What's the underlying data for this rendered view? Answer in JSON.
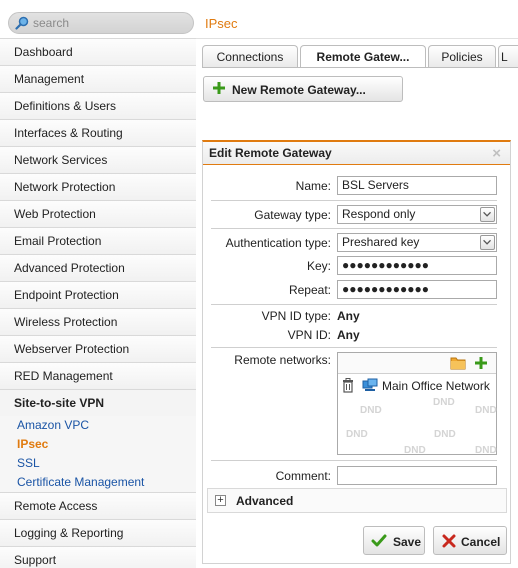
{
  "search": {
    "placeholder": "search"
  },
  "header": {
    "title": "IPsec"
  },
  "sidebar": {
    "items": [
      {
        "label": "Dashboard"
      },
      {
        "label": "Management"
      },
      {
        "label": "Definitions & Users"
      },
      {
        "label": "Interfaces & Routing"
      },
      {
        "label": "Network Services"
      },
      {
        "label": "Network Protection"
      },
      {
        "label": "Web Protection"
      },
      {
        "label": "Email Protection"
      },
      {
        "label": "Advanced Protection"
      },
      {
        "label": "Endpoint Protection"
      },
      {
        "label": "Wireless Protection"
      },
      {
        "label": "Webserver Protection"
      },
      {
        "label": "RED Management"
      }
    ],
    "section": {
      "label": "Site-to-site VPN"
    },
    "sub_items": [
      {
        "label": "Amazon VPC"
      },
      {
        "label": "IPsec"
      },
      {
        "label": "SSL"
      },
      {
        "label": "Certificate Management"
      }
    ],
    "bottom_items": [
      {
        "label": "Remote Access"
      },
      {
        "label": "Logging & Reporting"
      },
      {
        "label": "Support"
      }
    ]
  },
  "tabs": [
    {
      "label": "Connections"
    },
    {
      "label": "Remote Gatew..."
    },
    {
      "label": "Policies"
    },
    {
      "label": "L"
    }
  ],
  "toolbar": {
    "new_label": "New Remote Gateway..."
  },
  "dialog": {
    "title": "Edit Remote Gateway",
    "close": "×",
    "name_label": "Name:",
    "name_value": "BSL Servers",
    "gateway_type_label": "Gateway type:",
    "gateway_type_value": "Respond only",
    "auth_type_label": "Authentication type:",
    "auth_type_value": "Preshared key",
    "key_label": "Key:",
    "key_value": "●●●●●●●●●●●●",
    "repeat_label": "Repeat:",
    "repeat_value": "●●●●●●●●●●●●",
    "vpn_id_type_label": "VPN ID type:",
    "vpn_id_type_value": "Any",
    "vpn_id_label": "VPN ID:",
    "vpn_id_value": "Any",
    "remote_networks_label": "Remote networks:",
    "remote_networks": [
      {
        "label": "Main Office Network"
      }
    ],
    "dnd_label": "DND",
    "comment_label": "Comment:",
    "comment_value": "",
    "advanced_label": "Advanced",
    "advanced_toggle": "+",
    "save_label": "Save",
    "cancel_label": "Cancel"
  },
  "colors": {
    "accent": "#e07b10",
    "link": "#1a54a5",
    "add_green": "#3a9a1a",
    "cancel_red": "#c8281e"
  }
}
